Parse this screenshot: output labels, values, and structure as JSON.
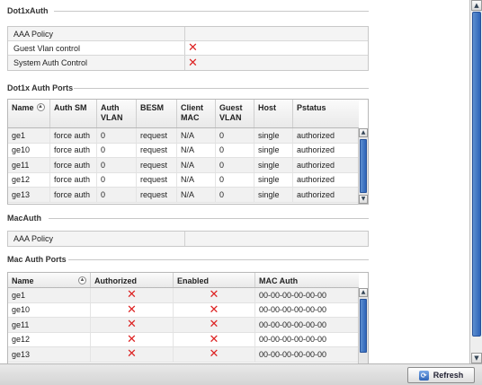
{
  "dot1x_auth": {
    "title": "Dot1xAuth",
    "rows": [
      {
        "label": "AAA Policy",
        "value": ""
      },
      {
        "label": "Guest Vlan control",
        "value": "✕"
      },
      {
        "label": "System Auth Control",
        "value": "✕"
      }
    ]
  },
  "dot1x_ports": {
    "title": "Dot1x Auth Ports",
    "columns": [
      "Name",
      "Auth SM",
      "Auth VLAN",
      "BESM",
      "Client MAC",
      "Guest VLAN",
      "Host",
      "Pstatus"
    ],
    "rows": [
      [
        "ge1",
        "force auth",
        "0",
        "request",
        "N/A",
        "0",
        "single",
        "authorized"
      ],
      [
        "ge10",
        "force auth",
        "0",
        "request",
        "N/A",
        "0",
        "single",
        "authorized"
      ],
      [
        "ge11",
        "force auth",
        "0",
        "request",
        "N/A",
        "0",
        "single",
        "authorized"
      ],
      [
        "ge12",
        "force auth",
        "0",
        "request",
        "N/A",
        "0",
        "single",
        "authorized"
      ],
      [
        "ge13",
        "force auth",
        "0",
        "request",
        "N/A",
        "0",
        "single",
        "authorized"
      ]
    ]
  },
  "mac_auth": {
    "title": "MacAuth",
    "rows": [
      {
        "label": "AAA Policy",
        "value": ""
      }
    ]
  },
  "mac_ports": {
    "title": "Mac Auth Ports",
    "columns": [
      "Name",
      "Authorized",
      "Enabled",
      "MAC Auth"
    ],
    "rows": [
      [
        "ge1",
        "✕",
        "✕",
        "00-00-00-00-00-00"
      ],
      [
        "ge10",
        "✕",
        "✕",
        "00-00-00-00-00-00"
      ],
      [
        "ge11",
        "✕",
        "✕",
        "00-00-00-00-00-00"
      ],
      [
        "ge12",
        "✕",
        "✕",
        "00-00-00-00-00-00"
      ],
      [
        "ge13",
        "✕",
        "✕",
        "00-00-00-00-00-00"
      ]
    ]
  },
  "footer": {
    "refresh_label": "Refresh",
    "refresh_icon": "refresh-icon"
  },
  "icons": {
    "sort": "▲",
    "scroll_up": "▲",
    "scroll_down": "▼",
    "refresh": "⟳"
  },
  "colors": {
    "x_mark": "#dd2222",
    "scroll_thumb": "#2e64b8"
  }
}
